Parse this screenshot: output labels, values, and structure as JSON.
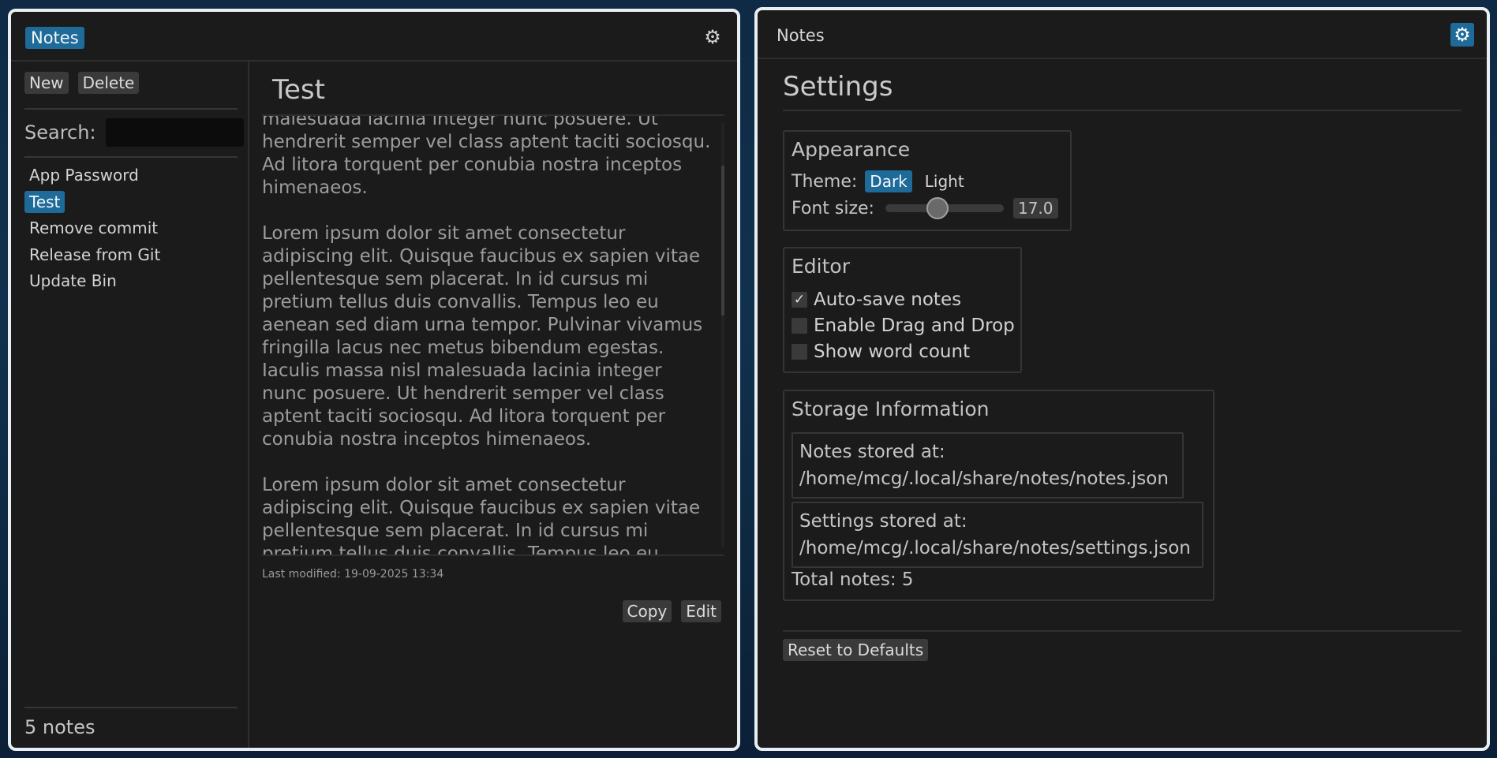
{
  "left_window": {
    "app_title": "Notes",
    "gear_icon": "gear-icon",
    "sidebar": {
      "new_label": "New",
      "delete_label": "Delete",
      "search_label": "Search:",
      "search_value": "",
      "notes": [
        "App Password",
        "Test",
        "Remove commit",
        "Release from Git",
        "Update Bin"
      ],
      "selected_note": "Test",
      "note_count": "5 notes"
    },
    "editor": {
      "title": "Test",
      "body": "malesuada lacinia integer nunc posuere. Ut hendrerit semper vel class aptent taciti sociosqu. Ad litora torquent per conubia nostra inceptos himenaeos.\n\nLorem ipsum dolor sit amet consectetur adipiscing elit. Quisque faucibus ex sapien vitae pellentesque sem placerat. In id cursus mi pretium tellus duis convallis. Tempus leo eu aenean sed diam urna tempor. Pulvinar vivamus fringilla lacus nec metus bibendum egestas. Iaculis massa nisl malesuada lacinia integer nunc posuere. Ut hendrerit semper vel class aptent taciti sociosqu. Ad litora torquent per conubia nostra inceptos himenaeos.\n\nLorem ipsum dolor sit amet consectetur adipiscing elit. Quisque faucibus ex sapien vitae pellentesque sem placerat. In id cursus mi pretium tellus duis convallis. Tempus leo eu aenean sed",
      "last_modified": "Last modified: 19-09-2025 13:34",
      "copy_label": "Copy",
      "edit_label": "Edit"
    }
  },
  "right_window": {
    "app_title": "Notes",
    "gear_icon": "gear-icon",
    "heading": "Settings",
    "appearance": {
      "title": "Appearance",
      "theme_label": "Theme:",
      "theme_options": [
        "Dark",
        "Light"
      ],
      "theme_selected": "Dark",
      "font_size_label": "Font size:",
      "font_size_value": "17.0",
      "font_size_fraction": 0.43
    },
    "editor": {
      "title": "Editor",
      "options": [
        {
          "label": "Auto-save notes",
          "checked": true
        },
        {
          "label": "Enable Drag and Drop",
          "checked": false
        },
        {
          "label": "Show word count",
          "checked": false
        }
      ]
    },
    "storage": {
      "title": "Storage Information",
      "notes_label": "Notes stored at:",
      "notes_path": "/home/mcg/.local/share/notes/notes.json",
      "settings_label": "Settings stored at:",
      "settings_path": "/home/mcg/.local/share/notes/settings.json",
      "total": "Total notes: 5"
    },
    "reset_label": "Reset to Defaults"
  },
  "colors": {
    "accent": "#1e6a99",
    "window_bg": "#1b1b1b",
    "button_bg": "#3a3a3a"
  }
}
